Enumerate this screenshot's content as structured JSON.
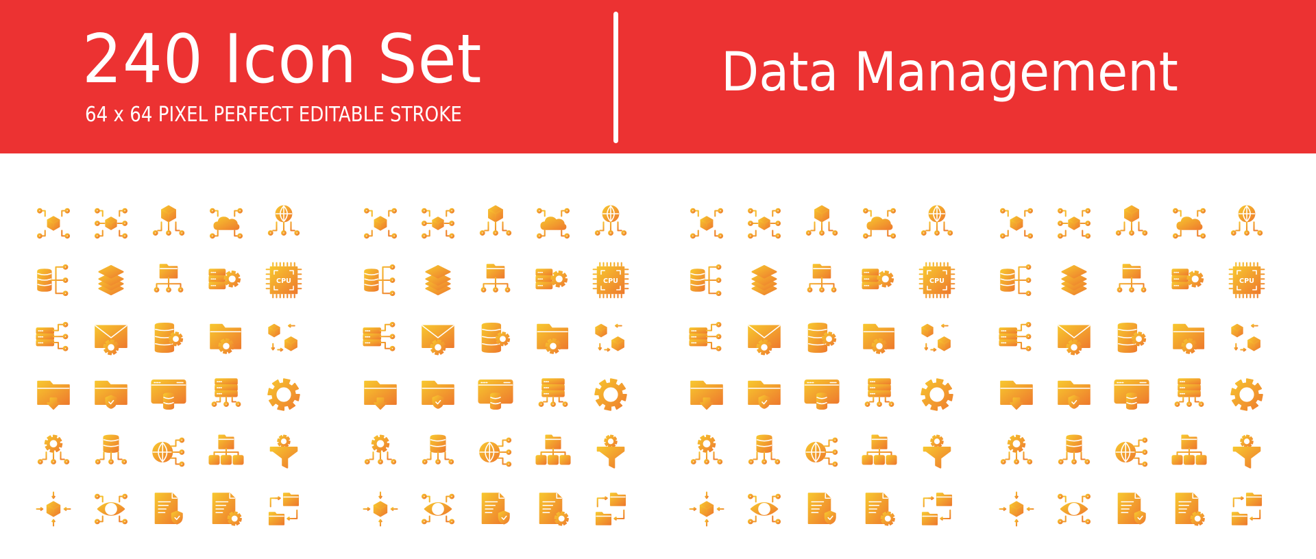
{
  "banner": {
    "title": "240 Icon Set",
    "subtitle": "64 x 64 PIXEL PERFECT EDITABLE STROKE",
    "topic": "Data Management",
    "background_color": "#ec3232",
    "text_color": "#ffffff"
  },
  "icons": [
    "network-cube-icon",
    "network-cube-six-nodes-icon",
    "cube-hierarchy-icon",
    "cloud-network-icon",
    "globe-network-icon",
    "database-connections-icon",
    "layers-icon",
    "folder-hierarchy-icon",
    "server-settings-icon",
    "cpu-chip-icon",
    "server-connections-icon",
    "mail-settings-icon",
    "database-settings-icon",
    "folder-settings-icon",
    "cube-exchange-icon",
    "folder-download-icon",
    "folder-shield-icon",
    "web-database-icon",
    "server-hierarchy-icon",
    "code-gear-icon",
    "gear-hierarchy-icon",
    "database-hierarchy-icon",
    "globe-connections-icon",
    "folder-org-chart-icon",
    "funnel-gear-icon",
    "cube-converge-icon",
    "eye-network-icon",
    "document-shield-icon",
    "document-settings-icon",
    "folder-exchange-icon"
  ],
  "panels": [
    {
      "style": "line",
      "color": "#1a1a1a"
    },
    {
      "style": "glyph",
      "color": "#000000"
    },
    {
      "style": "gradient-line",
      "palette": [
        [
          "#f7c62f",
          "#ee7b2d"
        ],
        [
          "#b07ac9",
          "#6650a8"
        ],
        [
          "#6bc48a",
          "#2aa79b"
        ],
        [
          "#f2958a",
          "#e64a76"
        ],
        [
          "#2aa6de",
          "#3b5ba9"
        ]
      ]
    },
    {
      "style": "gradient-solid",
      "palette": [
        [
          "#2aa6de",
          "#3b5ba9"
        ],
        [
          "#f2958a",
          "#e64a76"
        ],
        [
          "#6bc48a",
          "#2aa79b"
        ],
        [
          "#b07ac9",
          "#6650a8"
        ],
        [
          "#f7c62f",
          "#ee7b2d"
        ]
      ]
    }
  ]
}
